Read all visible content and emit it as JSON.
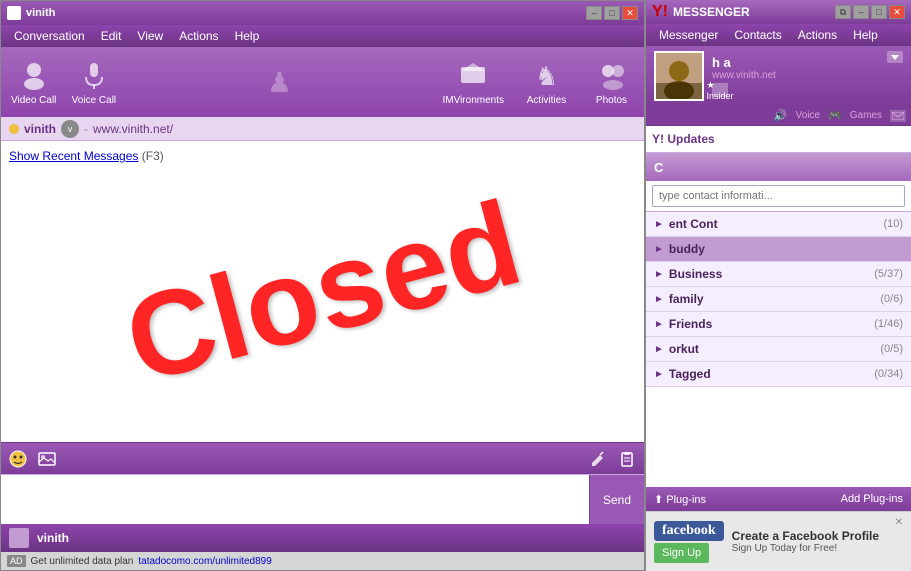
{
  "chat_window": {
    "title": "vinith",
    "title_controls": {
      "minimize": "–",
      "maximize": "□",
      "close": "✕"
    },
    "menu": {
      "items": [
        "Conversation",
        "Edit",
        "View",
        "Actions",
        "Help"
      ]
    },
    "toolbar": {
      "left_items": [
        {
          "name": "Video Call",
          "icon": "📷"
        },
        {
          "name": "Voice Call",
          "icon": "🎤"
        }
      ],
      "right_items": [
        {
          "name": "IMVironments",
          "icon": "🏠"
        },
        {
          "name": "Activities",
          "icon": "♟"
        },
        {
          "name": "Photos",
          "icon": "👤"
        }
      ]
    },
    "user_bar": {
      "name": "vinith",
      "separator": "-",
      "link": "www.vinith.net/"
    },
    "show_recent": {
      "text": "Show Recent Messages",
      "key": "(F3)"
    },
    "closed_text": "Closed",
    "input_toolbar": {
      "tools": [
        "😊",
        "🖼",
        "✏",
        "📋"
      ]
    },
    "send_button": "Send",
    "status_bar": {
      "name": "vinith"
    },
    "ad_bar": {
      "label": "AD",
      "text": "Get unlimited data plan",
      "link": "tatadocomo.com/unlimited899"
    }
  },
  "messenger_panel": {
    "title": "MESSENGER",
    "title_controls": {
      "restore": "⧉",
      "minimize": "–",
      "maximize": "□",
      "close": "✕"
    },
    "menu": {
      "items": [
        "Messenger",
        "Contacts",
        "Actions",
        "Help"
      ]
    },
    "profile": {
      "name": "h a",
      "link": "www.vinith.net",
      "insider_badge": "★ Insider"
    },
    "secondary_bar": {
      "items": [
        "Voice",
        "Games"
      ]
    },
    "updates_section": {
      "header": "Y! Updates"
    },
    "contacts_header": "C",
    "search": {
      "placeholder": "type contact informati..."
    },
    "groups": [
      {
        "name": "ent Cont",
        "count": "(10)",
        "highlighted": false,
        "arrow": "►"
      },
      {
        "name": "buddy",
        "count": "",
        "highlighted": true,
        "arrow": "►"
      },
      {
        "name": "Business",
        "count": "(5/37)",
        "highlighted": false,
        "arrow": "►"
      },
      {
        "name": "family",
        "count": "(0/6)",
        "highlighted": false,
        "arrow": "►"
      },
      {
        "name": "Friends",
        "count": "(1/46)",
        "highlighted": false,
        "arrow": "►"
      },
      {
        "name": "orkut",
        "count": "(0/5)",
        "highlighted": false,
        "arrow": "►"
      },
      {
        "name": "Tagged",
        "count": "(0/34)",
        "highlighted": false,
        "arrow": "►"
      }
    ],
    "plugins_bar": {
      "label": "⬆ Plug-ins",
      "add": "Add Plug-ins"
    },
    "fb_ad": {
      "logo": "facebook",
      "title": "Create a Facebook Profile",
      "subtitle": "Sign Up Today for Free!",
      "button": "Sign Up"
    }
  }
}
